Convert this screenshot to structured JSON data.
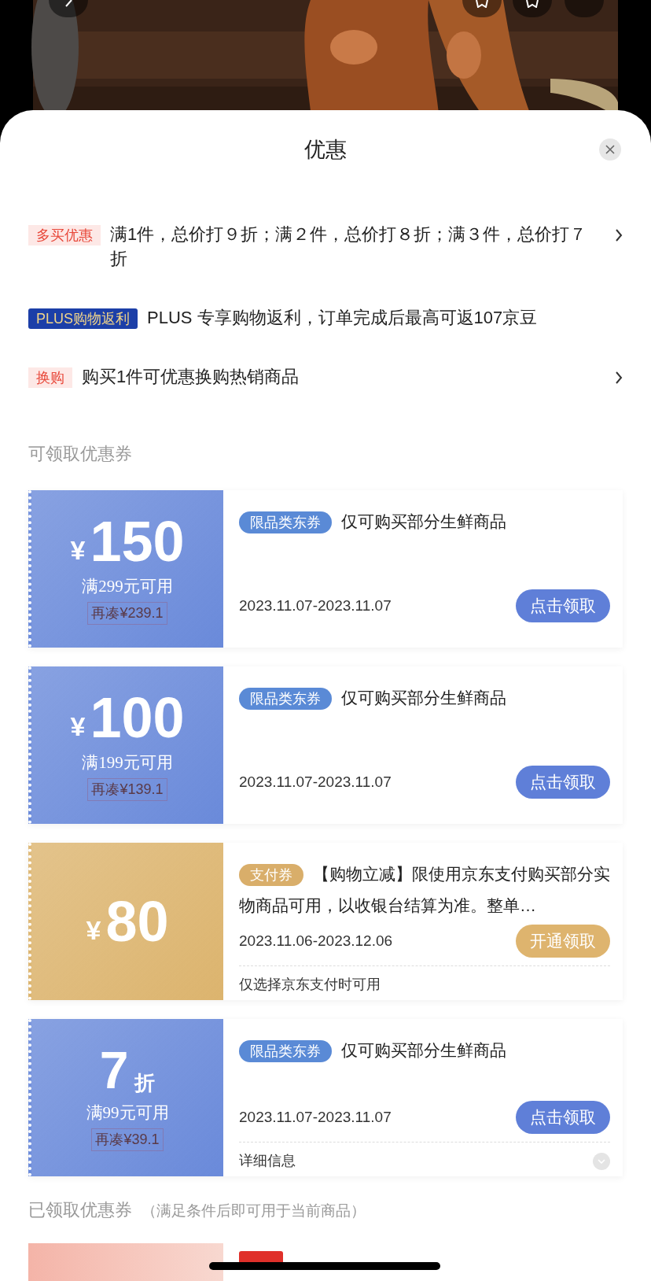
{
  "sheet": {
    "title": "优惠"
  },
  "promotions": [
    {
      "tag": "多买优惠",
      "kind": "light",
      "text": "满1件，总价打９折；满２件，总价打８折；满３件，总价打７折",
      "has_arrow": true
    },
    {
      "tag": "PLUS购物返利",
      "kind": "plus",
      "text": "PLUS 专享购物返利，订单完成后最高可返107京豆",
      "has_arrow": false
    },
    {
      "tag": "换购",
      "kind": "light",
      "text": "购买1件可优惠换购热销商品",
      "has_arrow": true
    }
  ],
  "available_section": {
    "title": "可领取优惠券"
  },
  "coupons": [
    {
      "kind": "amount",
      "color": "#6a8ada",
      "symbol": "¥",
      "value": "150",
      "condition": "满299元可用",
      "gap": "再凑¥239.1",
      "tag": "限品类东券",
      "description": "仅可购买部分生鲜商品",
      "date": "2023.11.07-2023.11.07",
      "button": "点击领取"
    },
    {
      "kind": "amount",
      "color": "#6a8ada",
      "symbol": "¥",
      "value": "100",
      "condition": "满199元可用",
      "gap": "再凑¥139.1",
      "tag": "限品类东券",
      "description": "仅可购买部分生鲜商品",
      "date": "2023.11.07-2023.11.07",
      "button": "点击领取"
    },
    {
      "kind": "amount",
      "color": "#dcb46e",
      "symbol": "¥",
      "value": "80",
      "tag": "支付券",
      "description": "【购物立减】限使用京东支付购买部分实物商品可用，以收银台结算为准。整单…",
      "date": "2023.11.06-2023.12.06",
      "button": "开通领取",
      "footer": {
        "kind": "note",
        "text": "仅选择京东支付时可用"
      }
    },
    {
      "kind": "discount",
      "color": "#6a8ada",
      "value": "7",
      "unit": "折",
      "condition": "满99元可用",
      "gap": "再凑¥39.1",
      "tag": "限品类东券",
      "description": "仅可购买部分生鲜商品",
      "date": "2023.11.07-2023.11.07",
      "button": "点击领取",
      "footer": {
        "kind": "details",
        "text": "详细信息"
      }
    }
  ],
  "claimed_section": {
    "title": "已领取优惠券",
    "note": "（满足条件后即可用于当前商品）"
  }
}
